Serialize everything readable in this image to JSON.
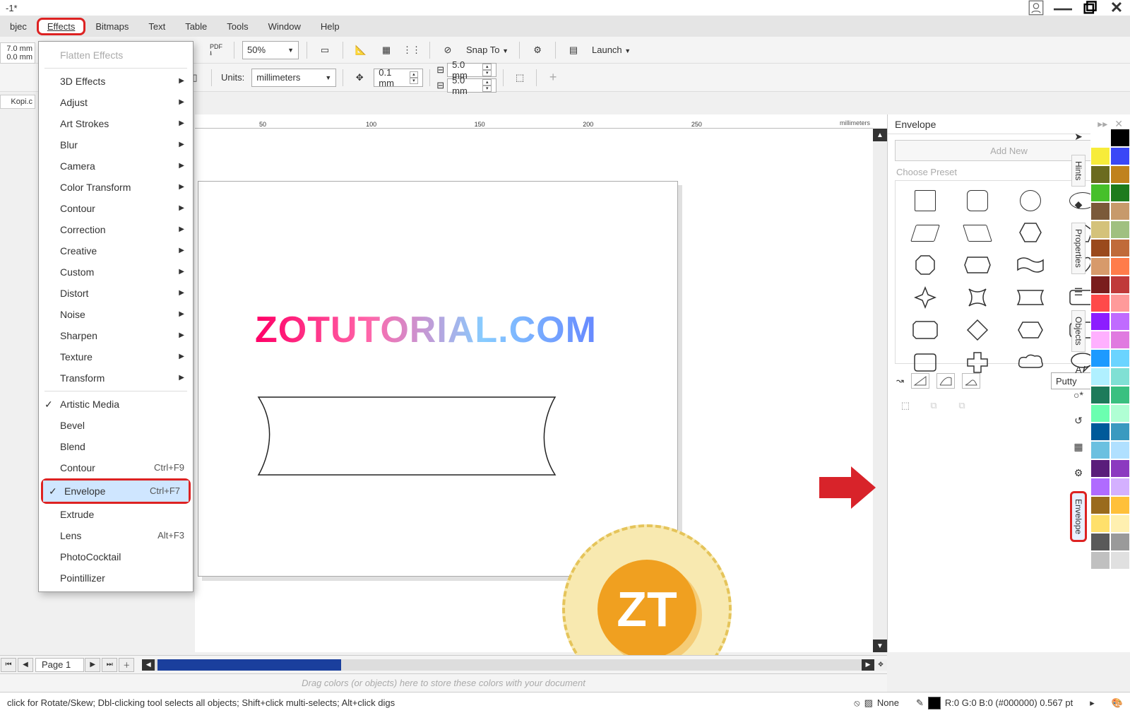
{
  "title_suffix": "-1*",
  "menubar": {
    "items": [
      "bjec",
      "Effects",
      "Bitmaps",
      "Text",
      "Table",
      "Tools",
      "Window",
      "Help"
    ],
    "underlined_idx": {
      "Bitmaps": 0,
      "Text": 2,
      "Table": 0,
      "Tools": 3,
      "Window": 0,
      "Help": 0,
      "Effects": 4
    }
  },
  "dropdown": {
    "disabled": "Flatten Effects",
    "submenu_items": [
      "3D Effects",
      "Adjust",
      "Art Strokes",
      "Blur",
      "Camera",
      "Color Transform",
      "Contour",
      "Correction",
      "Creative",
      "Custom",
      "Distort",
      "Noise",
      "Sharpen",
      "Texture",
      "Transform"
    ],
    "commands": [
      {
        "label": "Artistic Media",
        "checked": true
      },
      {
        "label": "Bevel"
      },
      {
        "label": "Blend"
      },
      {
        "label": "Contour",
        "shortcut": "Ctrl+F9"
      },
      {
        "label": "Envelope",
        "shortcut": "Ctrl+F7",
        "checked": true,
        "highlight": true
      },
      {
        "label": "Extrude"
      },
      {
        "label": "Lens",
        "shortcut": "Alt+F3"
      },
      {
        "label": "PhotoCocktail"
      },
      {
        "label": "Pointillizer"
      }
    ]
  },
  "toolbar1": {
    "zoom": "50%",
    "snap_label": "Snap To",
    "launch_label": "Launch"
  },
  "toolbar2": {
    "left_numbers": [
      "7.0 mm",
      "0.0 mm"
    ],
    "left_file_stub": "Kopi.c",
    "units_label": "Units:",
    "units_value": "millimeters",
    "nudge": "0.1 mm",
    "dup_x": "5.0 mm",
    "dup_y": "5.0 mm"
  },
  "ruler_ticks": [
    "50",
    "100",
    "150",
    "200",
    "250"
  ],
  "ruler_unit": "millimeters",
  "watermark_text": "ZOTUTORIAL.COM",
  "badge_text": "ZT",
  "docker": {
    "title": "Envelope",
    "add_new": "Add New",
    "choose": "Choose Preset",
    "mapping": "Putty"
  },
  "side_tabs": [
    "Hints",
    "Properties",
    "Objects"
  ],
  "side_tab_highlight": "Envelope",
  "palette_colors": [
    "#ffffff",
    "#000000",
    "#f7ec3a",
    "#3a47f7",
    "#6b6b1f",
    "#c0821d",
    "#46c02a",
    "#1d7b1d",
    "#7b5a3a",
    "#c79a6b",
    "#d4c27a",
    "#a0c080",
    "#9a4a1d",
    "#c06b3a",
    "#d79a6b",
    "#ff7c4a",
    "#7a1d1d",
    "#c03a3a",
    "#ff4a4a",
    "#ff9a9a",
    "#8c1dff",
    "#c06bff",
    "#ffb0ff",
    "#e07ae0",
    "#1d9aff",
    "#6bd4ff",
    "#b0f0ff",
    "#80e0d4",
    "#1d7b5a",
    "#3ac080",
    "#6bffb0",
    "#b0ffd4",
    "#005a9a",
    "#3a9ac0",
    "#6bc0e0",
    "#b0e0ff",
    "#5a1d7b",
    "#8c3ac0",
    "#b06bff",
    "#d4b0ff",
    "#9a6b1d",
    "#ffc03a",
    "#ffe06b",
    "#fff0b0",
    "#5a5a5a",
    "#9a9a9a",
    "#c0c0c0",
    "#e0e0e0"
  ],
  "pagebar": {
    "page_label": "Page 1"
  },
  "colordrag_hint": "Drag colors (or objects) here to store these colors with your document",
  "status": {
    "hint": "click for Rotate/Skew; Dbl-clicking tool selects all objects; Shift+click multi-selects; Alt+click digs",
    "fill": "None",
    "colorinfo": "R:0 G:0 B:0 (#000000)  0.567 pt"
  }
}
